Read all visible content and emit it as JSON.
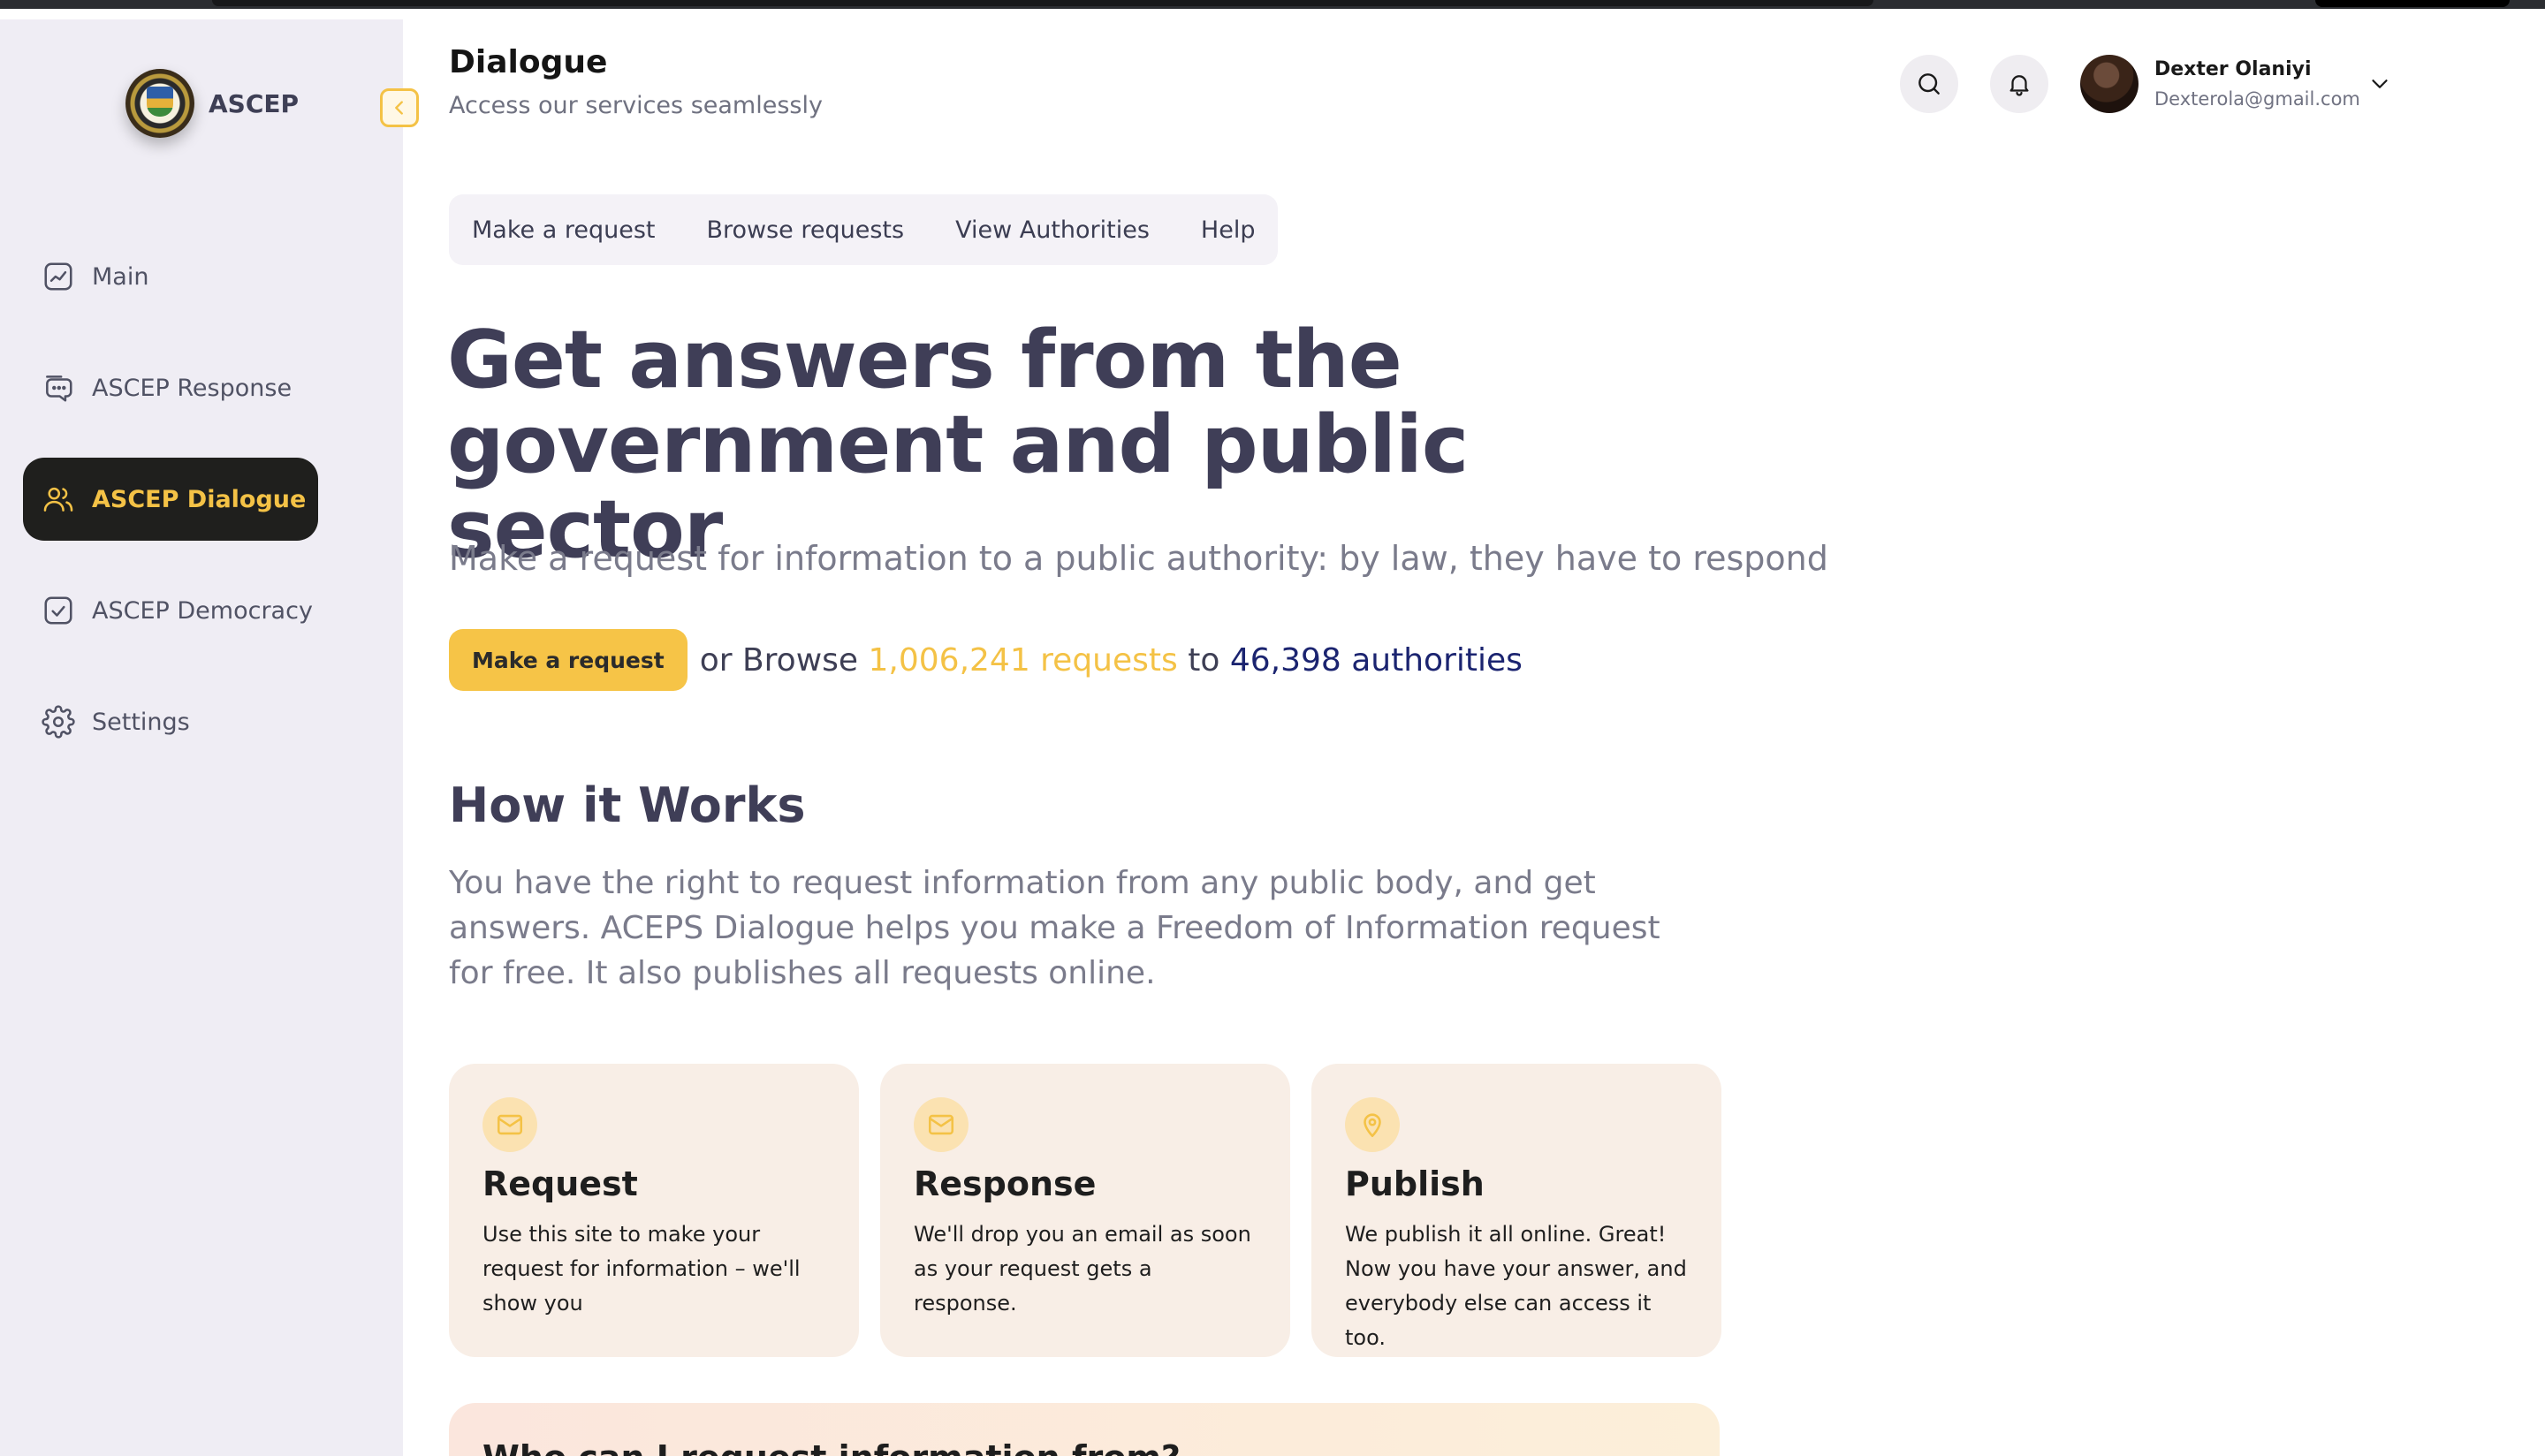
{
  "app": {
    "name": "ASCEP"
  },
  "sidebar": {
    "items": [
      {
        "label": "Main",
        "icon": "chart-line-icon"
      },
      {
        "label": "ASCEP Response",
        "icon": "chat-bubbles-icon"
      },
      {
        "label": "ASCEP Dialogue",
        "icon": "users-icon",
        "active": true
      },
      {
        "label": "ASCEP Democracy",
        "icon": "check-square-icon"
      },
      {
        "label": "Settings",
        "icon": "gear-icon"
      }
    ]
  },
  "header": {
    "title": "Dialogue",
    "subtitle": "Access our services seamlessly",
    "user": {
      "name": "Dexter Olaniyi",
      "email": "Dexterola@gmail.com"
    }
  },
  "tabs": [
    "Make a request",
    "Browse requests",
    "View Authorities",
    "Help"
  ],
  "hero": {
    "title": "Get answers from the government and public sector",
    "description": "Make a request for information to a public authority: by law, they have to respond",
    "cta_button": "Make a request",
    "cta_or": "or Browse",
    "requests_link": "1,006,241 requests",
    "cta_to": "to",
    "authorities_link": "46,398 authorities"
  },
  "how_it_works": {
    "title": "How it Works",
    "description": "You have the right to request information from any public body, and get answers. ACEPS Dialogue helps you make a Freedom of Information request for free. It also publishes all requests online."
  },
  "cards": [
    {
      "title": "Request",
      "text": "Use this site to make your request for information – we'll show you",
      "icon": "mail-icon"
    },
    {
      "title": "Response",
      "text": "We'll drop you an email as soon as your request gets a response.",
      "icon": "mail-icon"
    },
    {
      "title": "Publish",
      "text": "We publish it all online. Great! Now you have your answer, and everybody else can access it too.",
      "icon": "map-pin-icon"
    }
  ],
  "bottom_panel": {
    "title": "Who can I request information from?"
  },
  "colors": {
    "accent": "#f4c246",
    "navy": "#1b2470",
    "active_bg": "#1f1f1d"
  }
}
